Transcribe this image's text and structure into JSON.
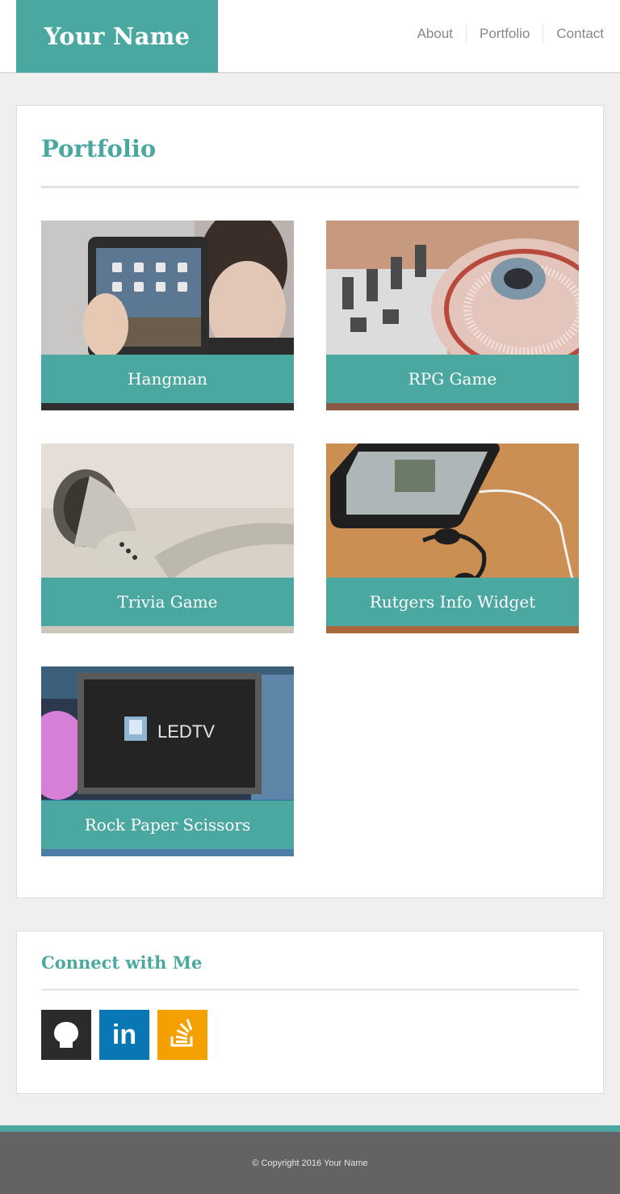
{
  "header": {
    "brand": "Your Name",
    "nav": [
      "About",
      "Portfolio",
      "Contact"
    ]
  },
  "portfolio": {
    "title": "Portfolio",
    "projects": [
      {
        "title": "Hangman",
        "image": "tablet-photo"
      },
      {
        "title": "RPG Game",
        "image": "turntable-photo"
      },
      {
        "title": "Trivia Game",
        "image": "earbuds-photo"
      },
      {
        "title": "Rutgers Info Widget",
        "image": "phone-headphones-photo"
      },
      {
        "title": "Rock Paper Scissors",
        "image": "led-tv-photo"
      }
    ]
  },
  "connect": {
    "title": "Connect with Me",
    "links": [
      {
        "name": "github-icon",
        "color": "#2b2b2b"
      },
      {
        "name": "linkedin-icon",
        "color": "#0a77b5"
      },
      {
        "name": "stackoverflow-icon",
        "color": "#f4a000"
      }
    ],
    "linkedin_text": "in",
    "tv_logo_text": "LEDTV"
  },
  "footer": {
    "copyright": "© Copyright 2016 Your Name"
  },
  "colors": {
    "accent": "#4aa8a1",
    "footer": "#636363",
    "background": "#efefef"
  }
}
